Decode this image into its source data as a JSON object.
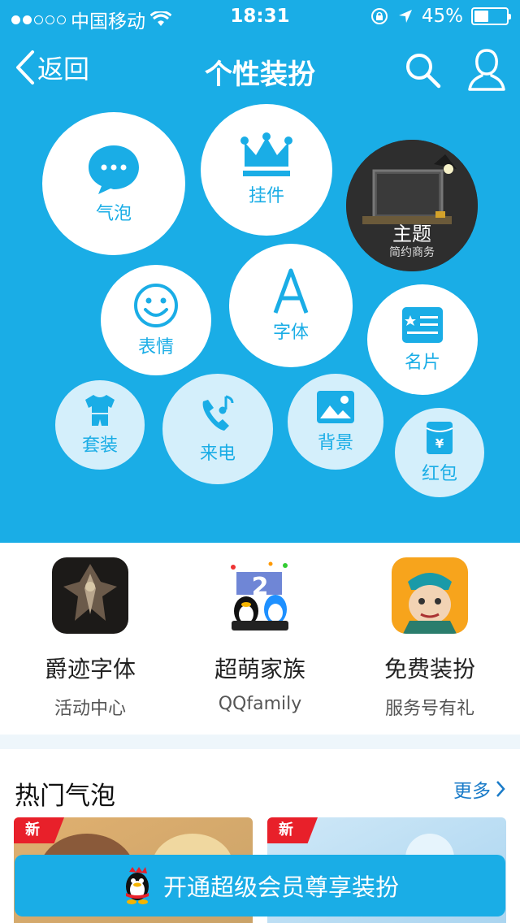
{
  "status_bar": {
    "carrier": "中国移动",
    "time": "18:31",
    "battery": "45%",
    "battery_level": 0.45
  },
  "nav": {
    "back_label": "返回",
    "title": "个性装扮"
  },
  "bubbles": {
    "bubble_chat": "气泡",
    "pendant": "挂件",
    "theme": "主题",
    "theme_sub": "简约商务",
    "emoji": "表情",
    "font": "字体",
    "card": "名片",
    "suit": "套装",
    "ringtone": "来电",
    "background": "背景",
    "redpacket": "红包"
  },
  "promos": [
    {
      "title": "爵迹字体",
      "subtitle": "活动中心"
    },
    {
      "title": "超萌家族",
      "subtitle": "QQfamily"
    },
    {
      "title": "免费装扮",
      "subtitle": "服务号有礼"
    }
  ],
  "hot_section": {
    "title": "热门气泡",
    "more_label": "更多",
    "cards": [
      {
        "tag": "新"
      },
      {
        "tag": "新"
      }
    ]
  },
  "cta": {
    "label": "开通超级会员尊享装扮"
  },
  "colors": {
    "accent": "#1aade6",
    "new_tag": "#e8202a"
  }
}
